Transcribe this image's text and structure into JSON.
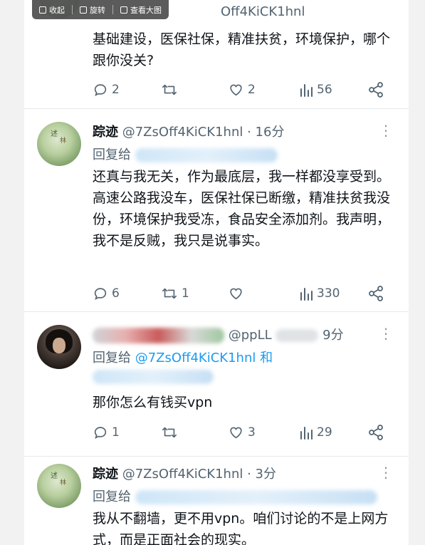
{
  "toolbar": {
    "collect": "收起",
    "rotate": "旋转",
    "view_large": "查看大图"
  },
  "tweet0": {
    "handle_partial": "Off4KiCK1hnl",
    "text": "基础建设，医保社保，精准扶贫，环境保护，哪个跟你没关?",
    "replies": "2",
    "retweets": "",
    "likes": "2",
    "views": "56"
  },
  "tweet1": {
    "name": "踪迹",
    "handle": "@7ZsOff4KiCK1hnl",
    "time": "· 16分",
    "reply_prefix": "回复给",
    "text": "还真与我无关，作为最底层，我一样都没享受到。高速公路我没车，医保社保已断缴，精准扶贫我没份，环境保护我受冻，食品安全添加剂。我声明，我不是反贼，我只是说事实。",
    "replies": "6",
    "retweets": "1",
    "likes": "",
    "views": "330"
  },
  "tweet2": {
    "handle_partial": "@ppLL",
    "time": "9分",
    "reply_prefix": "回复给",
    "reply_to": "@7ZsOff4KiCK1hnl",
    "reply_and": "和",
    "text": "那你怎么有钱买vpn",
    "replies": "1",
    "retweets": "",
    "likes": "3",
    "views": "29"
  },
  "tweet3": {
    "name": "踪迹",
    "handle": "@7ZsOff4KiCK1hnl",
    "time": "· 3分",
    "reply_prefix": "回复给",
    "text": "我从不翻墙，更不用vpn。咱们讨论的不是上网方式，而是正面社会的现实。"
  },
  "avatar_glyphs": {
    "green_top": "述",
    "green_bottom": "林"
  },
  "colors": {
    "text": "#0f1419",
    "secondary": "#536471",
    "accent": "#1d9bf0",
    "divider": "#e7e9eb"
  }
}
